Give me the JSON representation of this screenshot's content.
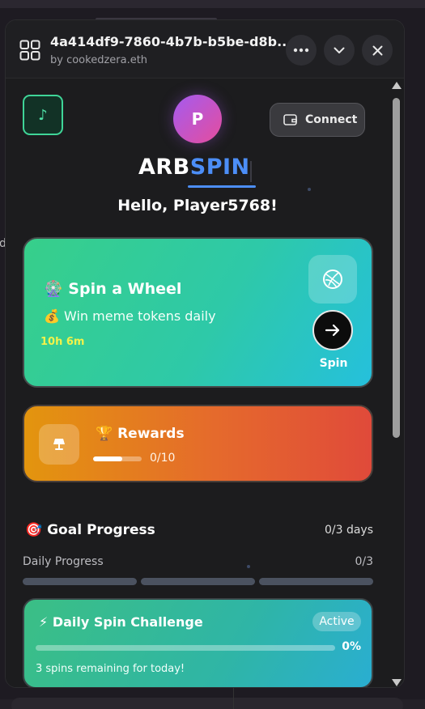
{
  "header": {
    "title": "4a414df9-7860-4b7b-b5be-d8b...",
    "subtitle": "by cookedzera.eth"
  },
  "top": {
    "avatar_initial": "P",
    "connect_label": "Connect",
    "logo_part1": "ARB",
    "logo_part2": "SPIN",
    "greeting": "Hello, Player5768!"
  },
  "spin_card": {
    "title": "Spin a Wheel",
    "subtitle": "Win meme tokens daily",
    "timer": "10h 6m",
    "button_label": "Spin",
    "title_emoji": "🎡",
    "subtitle_emoji": "💰"
  },
  "rewards": {
    "title": "Rewards",
    "title_emoji": "🏆",
    "count": "0/10",
    "progress": 0.6
  },
  "goal": {
    "title": "Goal Progress",
    "title_emoji": "🎯",
    "days": "0/3 days",
    "daily_label": "Daily Progress",
    "daily_count": "0/3"
  },
  "challenge": {
    "title": "Daily Spin Challenge",
    "title_emoji": "⚡",
    "badge": "Active",
    "percent": "0%",
    "progress": 0,
    "note": "3 spins remaining for today!"
  },
  "colors": {
    "accent_blue": "#4c8ef7",
    "spin_green": "#37cf8a",
    "spin_cyan": "#25c0dc",
    "rewards_orange": "#e3950e",
    "rewards_red": "#e04a3a",
    "music_green": "#3fd598"
  },
  "icons": [
    "app-grid-icon",
    "more-icon",
    "chevron-down-icon",
    "close-icon",
    "music-note-icon",
    "wallet-icon",
    "globe-icon",
    "arrow-right-icon",
    "lamp-icon"
  ]
}
